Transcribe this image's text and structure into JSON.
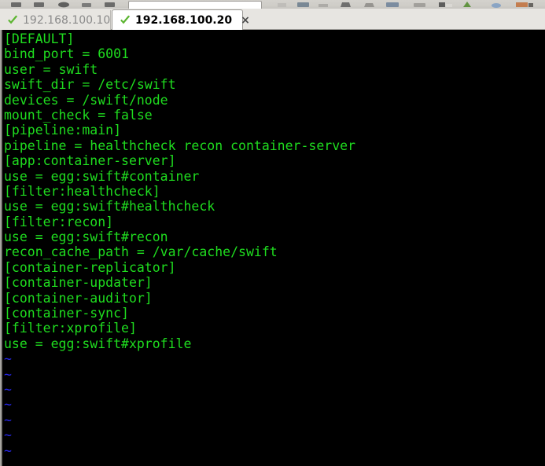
{
  "window": {
    "title_bar_visible": false
  },
  "toolbar": {
    "icons": [
      "back-icon",
      "forward-icon",
      "reload-icon",
      "stop-icon",
      "home-icon",
      "bookmark-icon",
      "download-icon",
      "print-icon",
      "settings-icon",
      "fullscreen-icon",
      "log-icon",
      "plugin-icon",
      "info-icon",
      "terminal-icon"
    ],
    "address_field_value": ""
  },
  "tabs": [
    {
      "label": "192.168.100.10",
      "icon": "connected-check-icon",
      "active": false,
      "closable": false
    },
    {
      "label": "192.168.100.20",
      "icon": "connected-check-icon",
      "active": true,
      "closable": true,
      "close_label": "×"
    }
  ],
  "colors": {
    "terminal_background": "#000000",
    "terminal_text": "#1fdd1f",
    "tilde_marker": "#2727e8",
    "tab_active_background": "#ffffff",
    "tab_inactive_text": "#8a8a8a",
    "tab_bar_background": "#e7e5e1",
    "check_icon": "#5cb531"
  },
  "terminal": {
    "lines": [
      "[DEFAULT]",
      "bind_port = 6001",
      "user = swift",
      "swift_dir = /etc/swift",
      "devices = /swift/node",
      "mount_check = false",
      "[pipeline:main]",
      "pipeline = healthcheck recon container-server",
      "[app:container-server]",
      "use = egg:swift#container",
      "[filter:healthcheck]",
      "use = egg:swift#healthcheck",
      "[filter:recon]",
      "use = egg:swift#recon",
      "recon_cache_path = /var/cache/swift",
      "[container-replicator]",
      "[container-updater]",
      "[container-auditor]",
      "[container-sync]",
      "[filter:xprofile]",
      "use = egg:swift#xprofile"
    ],
    "empty_markers": [
      "~",
      "~",
      "~",
      "~",
      "~",
      "~",
      "~"
    ]
  }
}
